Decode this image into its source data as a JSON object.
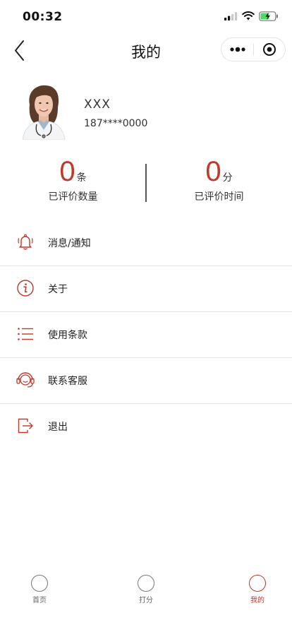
{
  "status_bar": {
    "time": "00:32"
  },
  "nav": {
    "title": "我的"
  },
  "profile": {
    "name": "XXX",
    "phone": "187****0000"
  },
  "stats": [
    {
      "value": "0",
      "unit": "条",
      "label": "已评价数量"
    },
    {
      "value": "0",
      "unit": "分",
      "label": "已评价时间"
    }
  ],
  "menu": [
    {
      "label": "消息/通知",
      "icon": "bell-icon"
    },
    {
      "label": "关于",
      "icon": "info-icon"
    },
    {
      "label": "使用条款",
      "icon": "list-icon"
    },
    {
      "label": "联系客服",
      "icon": "headset-icon"
    },
    {
      "label": "退出",
      "icon": "logout-icon"
    }
  ],
  "tabs": [
    {
      "label": "首页",
      "active": false
    },
    {
      "label": "打分",
      "active": false
    },
    {
      "label": "我的",
      "active": true
    }
  ],
  "colors": {
    "accent": "#c0392b",
    "text": "#222222",
    "divider": "#e6e6e6",
    "inactive_tab": "#666666"
  }
}
